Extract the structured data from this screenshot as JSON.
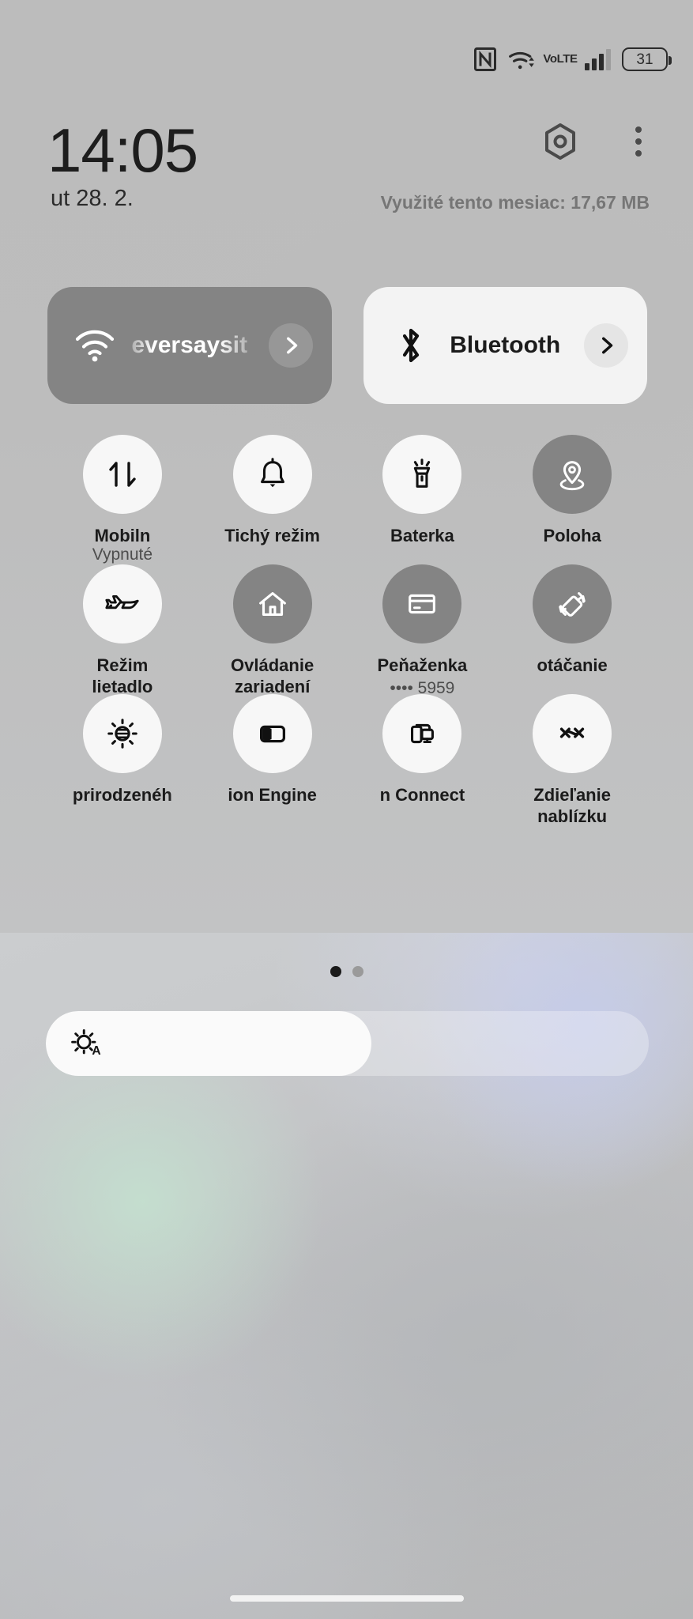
{
  "statusbar": {
    "nfc_icon": "nfc-icon",
    "wifi_icon": "wifi-icon",
    "volte_top": "Vo",
    "volte_bottom": "LTE",
    "signal_icon": "signal-bars-icon",
    "battery_level": "31"
  },
  "header": {
    "clock": "14:05",
    "date": "ut 28. 2.",
    "data_usage": "Využité tento mesiac: 17,67 MB",
    "settings_icon": "hex-settings-icon",
    "more_icon": "kebab-menu-icon"
  },
  "cards": [
    {
      "id": "wifi",
      "icon": "wifi-icon",
      "label": "eversaysit",
      "state": "on",
      "chevron": "chevron-right-icon"
    },
    {
      "id": "bluetooth",
      "icon": "bluetooth-icon",
      "label": "Bluetooth",
      "state": "off",
      "chevron": "chevron-right-icon"
    }
  ],
  "tiles": [
    {
      "id": "mobile-data",
      "icon": "data-transfer-icon",
      "label": "Mobiln",
      "sub": "Vypnuté",
      "state": "off",
      "marquee": true
    },
    {
      "id": "silent-mode",
      "icon": "bell-icon",
      "label": "Tichý režim",
      "sub": "",
      "state": "off",
      "marquee": false
    },
    {
      "id": "flashlight",
      "icon": "flashlight-icon",
      "label": "Baterka",
      "sub": "",
      "state": "off",
      "marquee": false
    },
    {
      "id": "location",
      "icon": "location-pin-icon",
      "label": "Poloha",
      "sub": "",
      "state": "on",
      "marquee": false
    },
    {
      "id": "airplane-mode",
      "icon": "airplane-icon",
      "label": "Režim\nlietadlo",
      "sub": "",
      "state": "off",
      "marquee": false
    },
    {
      "id": "device-controls",
      "icon": "home-icon",
      "label": "Ovládanie\nzariadení",
      "sub": "",
      "state": "on",
      "marquee": false
    },
    {
      "id": "wallet",
      "icon": "card-icon",
      "label": "Peňaženka",
      "sub": "•••• 5959",
      "state": "on",
      "marquee": false
    },
    {
      "id": "auto-rotate",
      "icon": "rotate-icon",
      "label": "otáčanie",
      "sub": "",
      "state": "on",
      "marquee": true
    },
    {
      "id": "reading-mode",
      "icon": "sun-contrast-icon",
      "label": "prirodzenéh",
      "sub": "",
      "state": "off",
      "marquee": true
    },
    {
      "id": "vision-engine",
      "icon": "split-square-icon",
      "label": "ion Engine",
      "sub": "",
      "state": "off",
      "marquee": true
    },
    {
      "id": "xiaomi-connect",
      "icon": "cast-devices-icon",
      "label": "n Connect",
      "sub": "",
      "state": "off",
      "marquee": true
    },
    {
      "id": "nearby-share",
      "icon": "nearby-share-icon",
      "label": "Zdieľanie\nnablízku",
      "sub": "",
      "state": "off",
      "marquee": false
    }
  ],
  "pager": {
    "total": 2,
    "active_index": 0
  },
  "brightness": {
    "icon": "auto-brightness-icon",
    "percent": 54
  },
  "navigation": {
    "home_indicator": "home-indicator"
  },
  "colors": {
    "tile_on": "#848484",
    "tile_off": "#f7f7f7",
    "card_on": "#848484",
    "card_off": "#f3f3f3",
    "text_primary": "#1b1b1b",
    "text_secondary": "#4d4d4d",
    "data_usage_text": "#767676"
  }
}
